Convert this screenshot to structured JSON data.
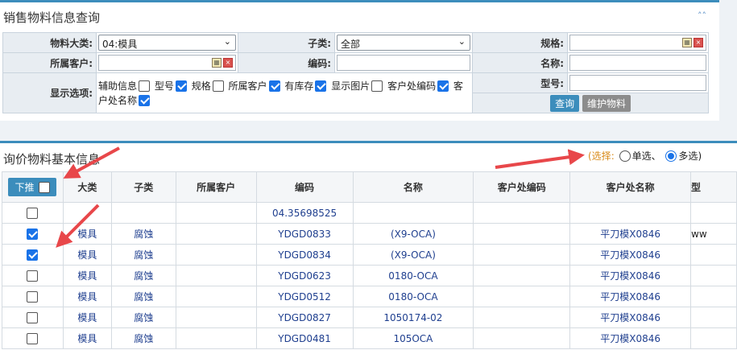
{
  "query_panel": {
    "title": "销售物料信息查询",
    "collapse_icon": "double-chevron-up-icon",
    "labels": {
      "category": "物料大类:",
      "subcategory": "子类:",
      "spec": "规格:",
      "customer": "所属客户:",
      "code": "编码:",
      "name": "名称:",
      "display_options": "显示选项:",
      "model": "型号:"
    },
    "category_value": "04:模具",
    "subcategory_value": "全部",
    "options": {
      "aux": "辅助信息",
      "model": "型号",
      "spec": "规格",
      "customer": "所属客户",
      "stock": "有库存",
      "show_image": "显示图片",
      "cust_code": "客户处编码",
      "cust_name": "客户处名称"
    },
    "buttons": {
      "query": "查询",
      "maintain": "维护物料"
    }
  },
  "result_panel": {
    "title": "询价物料基本信息",
    "select_label": "(选择",
    "select_colon": ":",
    "single": "单选",
    "sep": "、",
    "multi": "多选",
    "close_paren": ")",
    "push_label": "下推",
    "headers": [
      "大类",
      "子类",
      "所属客户",
      "编码",
      "名称",
      "客户处编码",
      "客户处名称",
      "型"
    ],
    "rows": [
      {
        "checked": false,
        "cat": "",
        "sub": "",
        "cust": "",
        "code": "04.35698525",
        "name": "",
        "cust_code": "",
        "cust_name": "",
        "model": ""
      },
      {
        "checked": true,
        "cat": "模具",
        "sub": "腐蚀",
        "cust": "",
        "code": "YDGD0833",
        "name": "(X9-OCA)",
        "cust_code": "",
        "cust_name": "平刀模X0846",
        "model": "ww"
      },
      {
        "checked": true,
        "cat": "模具",
        "sub": "腐蚀",
        "cust": "",
        "code": "YDGD0834",
        "name": "(X9-OCA)",
        "cust_code": "",
        "cust_name": "平刀模X0846",
        "model": ""
      },
      {
        "checked": false,
        "cat": "模具",
        "sub": "腐蚀",
        "cust": "",
        "code": "YDGD0623",
        "name": "0180-OCA",
        "cust_code": "",
        "cust_name": "平刀模X0846",
        "model": ""
      },
      {
        "checked": false,
        "cat": "模具",
        "sub": "腐蚀",
        "cust": "",
        "code": "YDGD0512",
        "name": "0180-OCA",
        "cust_code": "",
        "cust_name": "平刀模X0846",
        "model": ""
      },
      {
        "checked": false,
        "cat": "模具",
        "sub": "腐蚀",
        "cust": "",
        "code": "YDGD0827",
        "name": "1050174-02",
        "cust_code": "",
        "cust_name": "平刀模X0846",
        "model": ""
      },
      {
        "checked": false,
        "cat": "模具",
        "sub": "腐蚀",
        "cust": "",
        "code": "YDGD0481",
        "name": "105OCA",
        "cust_code": "",
        "cust_name": "平刀模X0846",
        "model": ""
      }
    ]
  },
  "colors": {
    "accent": "#3c8dbc",
    "checkbox": "#1a73e8",
    "annotation_arrow": "#e8474a",
    "select_label": "#d98b1a"
  }
}
